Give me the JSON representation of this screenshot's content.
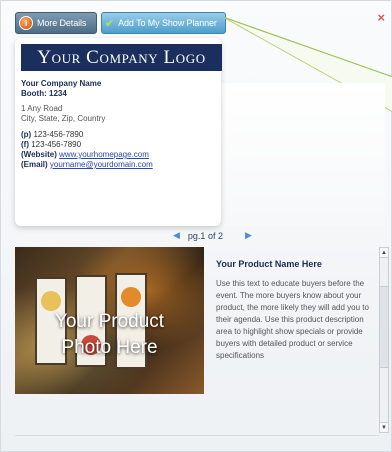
{
  "toolbar": {
    "more_details": "More Details",
    "add_planner": "Add To My Show Planner"
  },
  "close_icon": "×",
  "company": {
    "logo": "Your Company Logo",
    "name": "Your Company Name",
    "booth": "Booth: 1234",
    "address1": "1 Any Road",
    "address2": "City, State, Zip, Country",
    "phone_label": "(p)",
    "phone": "123-456-7890",
    "fax_label": "(f)",
    "fax": "123-456-7890",
    "website_label": "(Website)",
    "website": "www.yourhomepage.com",
    "email_label": "(Email)",
    "email": "yourname@yourdomain.com"
  },
  "pager": {
    "label": "pg.1 of 2",
    "prev_icon": "◀",
    "next_icon": "▶"
  },
  "product": {
    "photo_line1": "Your Product",
    "photo_line2": "Photo Here",
    "name": "Your Product Name Here",
    "description": "Use this text to educate buyers before the event. The more buyers know about your product, the more likely they will add you to their agenda. Use this product description area to highlight show specials or provide buyers with detailed product or service specifications"
  },
  "scrollbar": {
    "up_icon": "▲",
    "down_icon": "▼"
  },
  "colors": {
    "logo_bg": "#1b2f5e",
    "accent_blue": "#4e9ec9",
    "close": "#d85a4a"
  }
}
